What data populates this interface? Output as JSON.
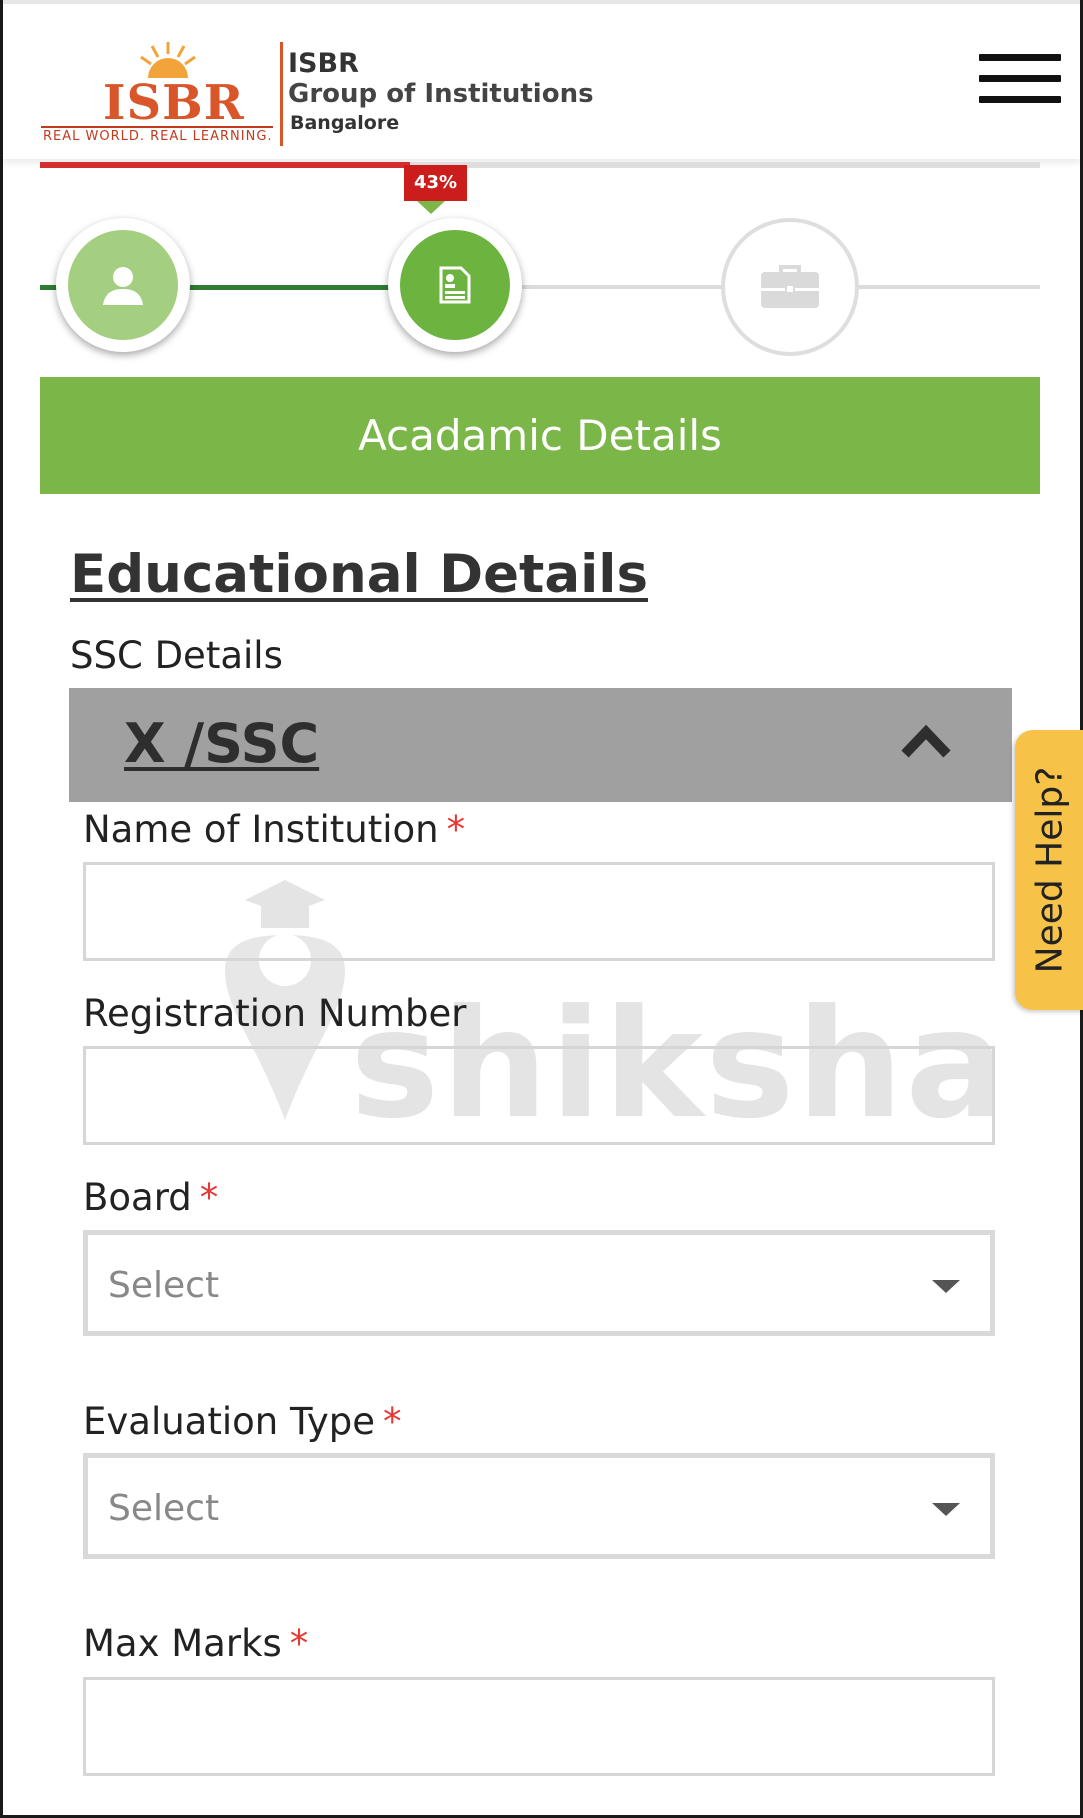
{
  "header": {
    "logo_text": "ISBR",
    "logo_tagline": "REAL WORLD. REAL LEARNING.",
    "brand_title": "ISBR",
    "brand_subtitle": "Group of Institutions",
    "brand_city": "Bangalore",
    "menu_icon": "hamburger-menu-icon"
  },
  "progress": {
    "percent_label": "43%",
    "percent_value": 43,
    "fill_color": "#d32f2f",
    "steps": [
      {
        "icon": "user-icon",
        "state": "completed"
      },
      {
        "icon": "document-icon",
        "state": "active"
      },
      {
        "icon": "briefcase-icon",
        "state": "pending"
      }
    ]
  },
  "section_title": "Acadamic Details",
  "education": {
    "title": "Educational Details",
    "ssc_label": "SSC Details",
    "accordion_title": "X /SSC",
    "accordion_icon": "chevron-up-icon",
    "fields": {
      "institution_label": "Name of Institution",
      "registration_label": "Registration Number",
      "board_label": "Board",
      "board_value": "Select",
      "evaluation_label": "Evaluation Type",
      "evaluation_value": "Select",
      "max_marks_label": "Max Marks",
      "required_mark": "*"
    }
  },
  "help_tab": "Need Help?",
  "watermark": "shiksha",
  "colors": {
    "accent_green": "#7ab648",
    "required_red": "#e53935",
    "help_yellow": "#f6c348",
    "accordion_gray": "#a0a0a0"
  }
}
